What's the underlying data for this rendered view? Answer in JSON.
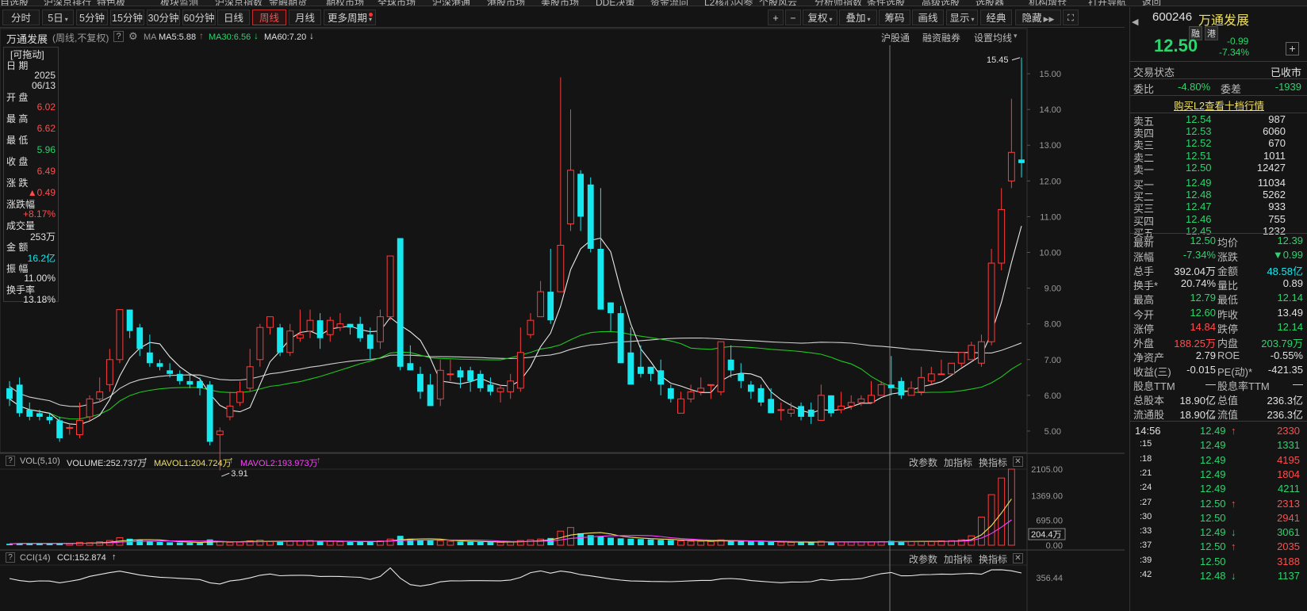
{
  "menubar": [
    "自选股",
    "沪深京排行",
    "特色板",
    "板块监测",
    "沪深京指数",
    "金融期货",
    "期权市场",
    "全球市场",
    "沪深港通",
    "港股市场",
    "美股市场",
    "DDE决策",
    "资金流向",
    "L2核心内参",
    "个股风云",
    "分析师指数",
    "条件选股",
    "高级选股",
    "选股器",
    "机构增仓",
    "打开导航",
    "返回"
  ],
  "toolbar": {
    "periods": [
      "分时",
      "5日",
      "5分钟",
      "15分钟",
      "30分钟",
      "60分钟",
      "日线",
      "周线",
      "月线",
      "更多周期"
    ],
    "active_period": "周线",
    "right_buttons": [
      "+",
      "−",
      "复权",
      "叠加",
      "筹码",
      "画线",
      "显示",
      "经典",
      "隐藏"
    ]
  },
  "chart_header": {
    "stock_name": "万通发展",
    "mode": "(周线,不复权)",
    "ma_label": "MA",
    "ma5": "MA5:5.88",
    "ma30": "MA30:6.56",
    "ma60": "MA60:7.20",
    "links": [
      "沪股通",
      "融资融券",
      "设置均线"
    ]
  },
  "infobox": {
    "drag_label": "[可拖动]",
    "fields": [
      {
        "label": "日  期",
        "value": "2025",
        "value2": "06/13",
        "color": "#e0e0e0"
      },
      {
        "label": "开  盘",
        "value": "6.02",
        "color": "#ff4d4d"
      },
      {
        "label": "最  高",
        "value": "6.62",
        "color": "#ff4d4d"
      },
      {
        "label": "最  低",
        "value": "5.96",
        "color": "#2bd46c"
      },
      {
        "label": "收  盘",
        "value": "6.49",
        "color": "#ff4d4d"
      },
      {
        "label": "涨  跌",
        "value": "▲0.49",
        "color": "#ff4d4d"
      },
      {
        "label": "涨跌幅",
        "value": "+8.17%",
        "color": "#ff4d4d"
      },
      {
        "label": "成交量",
        "value": "253万",
        "color": "#e0e0e0"
      },
      {
        "label": "金  额",
        "value": "16.2亿",
        "color": "#16e8ef"
      },
      {
        "label": "振  幅",
        "value": "11.00%",
        "color": "#e0e0e0"
      },
      {
        "label": "换手率",
        "value": "13.18%",
        "color": "#e0e0e0"
      }
    ]
  },
  "price_axis": [
    "15.00",
    "14.00",
    "13.00",
    "12.00",
    "11.00",
    "10.00",
    "9.00",
    "8.00",
    "7.00",
    "6.00",
    "5.00"
  ],
  "annotations": {
    "high": "15.45",
    "low": "3.91"
  },
  "volume_panel": {
    "title": "VOL(5,10)",
    "volume": "VOLUME:252.737万",
    "mavol1": "MAVOL1:204.724万",
    "mavol2": "MAVOL2:193.973万",
    "axis": [
      "2105.00",
      "1369.00",
      "695.00",
      "0.00"
    ],
    "current_label": "204.4万",
    "buttons": [
      "改参数",
      "加指标",
      "换指标"
    ]
  },
  "cci_panel": {
    "title": "CCI(14)",
    "value": "CCI:152.874",
    "axis": [
      "356.44"
    ],
    "buttons": [
      "改参数",
      "加指标",
      "换指标"
    ]
  },
  "quote": {
    "code": "600246",
    "name": "万通发展",
    "tags": [
      "融",
      "港"
    ],
    "price": "12.50",
    "change": "-0.99",
    "change_pct": "-7.34%",
    "status_label": "交易状态",
    "status_value": "已收市",
    "weibi_label": "委比",
    "weibi": "-4.80%",
    "weicha_label": "委差",
    "weicha": "-1939",
    "l2_link": "购买L2查看十档行情",
    "asks": [
      {
        "label": "卖五",
        "price": "12.54",
        "vol": "987"
      },
      {
        "label": "卖四",
        "price": "12.53",
        "vol": "6060"
      },
      {
        "label": "卖三",
        "price": "12.52",
        "vol": "670"
      },
      {
        "label": "卖二",
        "price": "12.51",
        "vol": "1011"
      },
      {
        "label": "卖一",
        "price": "12.50",
        "vol": "12427"
      }
    ],
    "bids": [
      {
        "label": "买一",
        "price": "12.49",
        "vol": "11034"
      },
      {
        "label": "买二",
        "price": "12.48",
        "vol": "5262"
      },
      {
        "label": "买三",
        "price": "12.47",
        "vol": "933"
      },
      {
        "label": "买四",
        "price": "12.46",
        "vol": "755"
      },
      {
        "label": "买五",
        "price": "12.45",
        "vol": "1232"
      }
    ],
    "stats": [
      [
        "最新",
        "12.50",
        "green",
        "均价",
        "12.39",
        "green"
      ],
      [
        "涨幅",
        "-7.34%",
        "green",
        "涨跌",
        "▼0.99",
        "green"
      ],
      [
        "总手",
        "392.04万",
        "white",
        "金额",
        "48.58亿",
        "cyan"
      ],
      [
        "换手*",
        "20.74%",
        "white",
        "量比",
        "0.89",
        "white"
      ],
      [
        "最高",
        "12.79",
        "green",
        "最低",
        "12.14",
        "green"
      ],
      [
        "今开",
        "12.60",
        "green",
        "昨收",
        "13.49",
        "white"
      ],
      [
        "涨停",
        "14.84",
        "red",
        "跌停",
        "12.14",
        "green"
      ],
      [
        "外盘",
        "188.25万",
        "red",
        "内盘",
        "203.79万",
        "green"
      ],
      [
        "净资产",
        "2.79",
        "white",
        "ROE",
        "-0.55%",
        "white"
      ],
      [
        "收益(三)",
        "-0.015",
        "white",
        "PE(动)*",
        "-421.35",
        "white"
      ],
      [
        "股息TTM",
        "—",
        "white",
        "股息率TTM",
        "—",
        "white"
      ],
      [
        "总股本",
        "18.90亿",
        "white",
        "总值",
        "236.3亿",
        "white"
      ],
      [
        "流通股",
        "18.90亿",
        "white",
        "流值",
        "236.3亿",
        "white"
      ]
    ],
    "ticks": [
      {
        "time": "14:56",
        "price": "12.49",
        "dir": "↑",
        "vol": "2330"
      },
      {
        "time": ":15",
        "price": "12.49",
        "dir": "",
        "vol": "1331"
      },
      {
        "time": ":18",
        "price": "12.49",
        "dir": "",
        "vol": "4195"
      },
      {
        "time": ":21",
        "price": "12.49",
        "dir": "",
        "vol": "1804"
      },
      {
        "time": ":24",
        "price": "12.49",
        "dir": "",
        "vol": "4211"
      },
      {
        "time": ":27",
        "price": "12.50",
        "dir": "↑",
        "vol": "2313"
      },
      {
        "time": ":30",
        "price": "12.50",
        "dir": "",
        "vol": "2941"
      },
      {
        "time": ":33",
        "price": "12.49",
        "dir": "↓",
        "vol": "3061"
      },
      {
        "time": ":37",
        "price": "12.50",
        "dir": "↑",
        "vol": "2035"
      },
      {
        "time": ":39",
        "price": "12.50",
        "dir": "",
        "vol": "3188"
      },
      {
        "time": ":42",
        "price": "12.48",
        "dir": "↓",
        "vol": "1137"
      }
    ]
  },
  "chart_data": {
    "type": "candlestick",
    "title": "万通发展 (周线,不复权)",
    "ylim": [
      4.4,
      15.8
    ],
    "candles": [
      [
        6.2,
        5.9,
        6.4,
        5.7
      ],
      [
        6.3,
        5.5,
        6.5,
        5.4
      ],
      [
        5.6,
        5.4,
        5.8,
        5.3
      ],
      [
        5.5,
        5.4,
        5.6,
        5.3
      ],
      [
        5.4,
        5.3,
        5.5,
        5.2
      ],
      [
        5.3,
        4.8,
        5.4,
        4.7
      ],
      [
        5.1,
        5.1,
        5.2,
        4.9
      ],
      [
        4.9,
        5.3,
        5.8,
        4.8
      ],
      [
        5.4,
        5.9,
        6.0,
        5.3
      ],
      [
        5.9,
        6.1,
        6.5,
        5.8
      ],
      [
        6.3,
        7.0,
        7.3,
        6.1
      ],
      [
        7.0,
        8.4,
        8.4,
        6.9
      ],
      [
        8.4,
        7.8,
        8.4,
        7.6
      ],
      [
        7.9,
        7.3,
        8.0,
        7.1
      ],
      [
        7.2,
        6.9,
        7.7,
        6.8
      ],
      [
        6.9,
        6.8,
        7.0,
        6.7
      ],
      [
        6.7,
        6.6,
        6.9,
        6.5
      ],
      [
        6.6,
        6.4,
        6.7,
        6.3
      ],
      [
        6.4,
        6.3,
        6.6,
        6.2
      ],
      [
        6.4,
        6.2,
        6.5,
        6.0
      ],
      [
        6.3,
        4.7,
        6.4,
        4.6
      ],
      [
        4.9,
        5.0,
        5.1,
        3.9
      ],
      [
        5.4,
        5.7,
        6.1,
        5.3
      ],
      [
        5.8,
        6.1,
        6.4,
        5.7
      ],
      [
        6.2,
        6.8,
        7.3,
        6.1
      ],
      [
        7.0,
        7.9,
        8.0,
        6.8
      ],
      [
        7.9,
        8.2,
        8.2,
        7.7
      ],
      [
        7.9,
        7.2,
        8.0,
        7.1
      ],
      [
        7.2,
        7.8,
        8.0,
        7.1
      ],
      [
        7.6,
        7.7,
        8.4,
        7.5
      ],
      [
        7.8,
        8.1,
        8.4,
        7.6
      ],
      [
        8.1,
        7.6,
        8.3,
        7.3
      ],
      [
        7.7,
        8.1,
        8.2,
        7.5
      ],
      [
        7.9,
        8.0,
        8.3,
        7.8
      ],
      [
        8.0,
        7.9,
        8.0,
        7.7
      ],
      [
        8.0,
        7.6,
        8.2,
        7.5
      ],
      [
        7.7,
        7.3,
        7.9,
        7.0
      ],
      [
        7.5,
        8.2,
        8.4,
        7.3
      ],
      [
        8.2,
        9.9,
        9.9,
        8.1
      ],
      [
        10.4,
        6.8,
        10.4,
        6.7
      ],
      [
        6.9,
        6.7,
        7.4,
        6.7
      ],
      [
        6.6,
        6.1,
        6.8,
        5.9
      ],
      [
        6.3,
        5.7,
        6.6,
        5.7
      ],
      [
        5.9,
        6.7,
        7.0,
        5.7
      ],
      [
        6.6,
        6.6,
        7.0,
        6.4
      ],
      [
        6.7,
        6.5,
        6.8,
        6.2
      ],
      [
        6.7,
        6.4,
        6.8,
        6.1
      ],
      [
        6.6,
        6.2,
        6.7,
        6.1
      ],
      [
        6.3,
        6.1,
        6.5,
        6.0
      ],
      [
        6.1,
        6.2,
        6.3,
        5.8
      ],
      [
        6.1,
        6.4,
        6.6,
        5.9
      ],
      [
        6.2,
        7.2,
        7.9,
        6.1
      ],
      [
        7.7,
        8.1,
        8.3,
        7.6
      ],
      [
        8.2,
        8.9,
        9.2,
        8.2
      ],
      [
        8.9,
        8.1,
        10.1,
        8.0
      ],
      [
        8.9,
        10.2,
        14.9,
        8.9
      ],
      [
        10.8,
        12.3,
        14.0,
        10.6
      ],
      [
        12.2,
        11.0,
        12.3,
        10.6
      ],
      [
        11.9,
        10.1,
        12.1,
        10.0
      ],
      [
        10.1,
        8.4,
        11.8,
        8.4
      ],
      [
        8.6,
        8.3,
        8.6,
        7.8
      ],
      [
        8.3,
        6.9,
        8.5,
        6.9
      ],
      [
        7.2,
        6.3,
        7.9,
        6.3
      ],
      [
        6.8,
        6.6,
        7.4,
        6.5
      ],
      [
        6.8,
        6.6,
        6.8,
        6.4
      ],
      [
        6.7,
        6.3,
        7.0,
        6.0
      ],
      [
        6.2,
        5.9,
        6.3,
        5.8
      ],
      [
        5.5,
        5.9,
        6.1,
        5.7
      ],
      [
        5.9,
        6.1,
        6.3,
        5.8
      ],
      [
        6.1,
        6.2,
        6.5,
        6.0
      ],
      [
        6.3,
        6.3,
        6.3,
        5.9
      ],
      [
        6.1,
        7.5,
        7.5,
        6.0
      ],
      [
        7.0,
        6.7,
        7.4,
        6.5
      ],
      [
        6.6,
        6.4,
        6.9,
        6.2
      ],
      [
        6.3,
        6.1,
        6.4,
        5.9
      ],
      [
        6.2,
        5.8,
        6.3,
        5.7
      ],
      [
        5.9,
        5.5,
        6.2,
        5.5
      ],
      [
        5.6,
        5.6,
        5.8,
        5.3
      ],
      [
        5.5,
        5.6,
        5.8,
        5.4
      ],
      [
        5.7,
        5.4,
        5.8,
        5.3
      ],
      [
        5.6,
        5.4,
        5.8,
        5.2
      ],
      [
        5.3,
        6.0,
        6.3,
        5.3
      ],
      [
        6.0,
        5.5,
        6.0,
        5.4
      ],
      [
        5.6,
        5.7,
        6.1,
        5.5
      ],
      [
        5.7,
        5.8,
        6.0,
        5.6
      ],
      [
        5.8,
        5.9,
        6.0,
        5.7
      ],
      [
        5.8,
        6.0,
        6.4,
        5.8
      ],
      [
        6.0,
        6.3,
        6.4,
        6.0
      ],
      [
        6.3,
        6.2,
        7.1,
        6.0
      ],
      [
        6.4,
        6.0,
        6.5,
        5.9
      ],
      [
        6.0,
        6.2,
        6.4,
        6.0
      ],
      [
        6.1,
        6.5,
        6.8,
        6.0
      ],
      [
        6.4,
        6.6,
        6.8,
        6.3
      ],
      [
        6.6,
        6.6,
        7.0,
        6.6
      ],
      [
        6.6,
        6.9,
        6.9,
        6.6
      ],
      [
        6.9,
        7.2,
        7.2,
        6.8
      ],
      [
        7.0,
        7.4,
        7.5,
        7.0
      ],
      [
        6.9,
        7.5,
        7.7,
        6.8
      ],
      [
        7.5,
        9.7,
        10.1,
        7.4
      ],
      [
        9.7,
        11.2,
        11.8,
        9.5
      ],
      [
        12.0,
        12.8,
        14.3,
        11.8
      ],
      [
        12.6,
        12.5,
        15.45,
        12.1
      ]
    ],
    "volumes": [
      40,
      55,
      60,
      50,
      45,
      55,
      40,
      80,
      70,
      95,
      130,
      210,
      180,
      140,
      110,
      90,
      80,
      75,
      70,
      65,
      160,
      100,
      80,
      85,
      120,
      140,
      110,
      100,
      115,
      120,
      130,
      110,
      105,
      95,
      90,
      110,
      100,
      120,
      170,
      260,
      180,
      150,
      130,
      125,
      110,
      100,
      95,
      90,
      85,
      80,
      90,
      130,
      150,
      170,
      200,
      390,
      490,
      330,
      280,
      250,
      210,
      190,
      180,
      170,
      160,
      150,
      140,
      120,
      110,
      110,
      100,
      150,
      120,
      110,
      100,
      95,
      90,
      85,
      80,
      85,
      80,
      110,
      90,
      90,
      85,
      90,
      95,
      100,
      120,
      105,
      100,
      105,
      110,
      120,
      125,
      150,
      260,
      780,
      1400,
      1860,
      2105
    ],
    "ma_lines": [
      "MA5",
      "MA30",
      "MA60"
    ],
    "colors": {
      "up": "#ff3b3b",
      "down": "#16e8ef",
      "ma5": "#e8e8e8",
      "ma30": "#1fc81f",
      "ma60": "#d0d0d0",
      "vol_ma1": "#f0e060",
      "vol_ma2": "#ff40ff"
    }
  }
}
